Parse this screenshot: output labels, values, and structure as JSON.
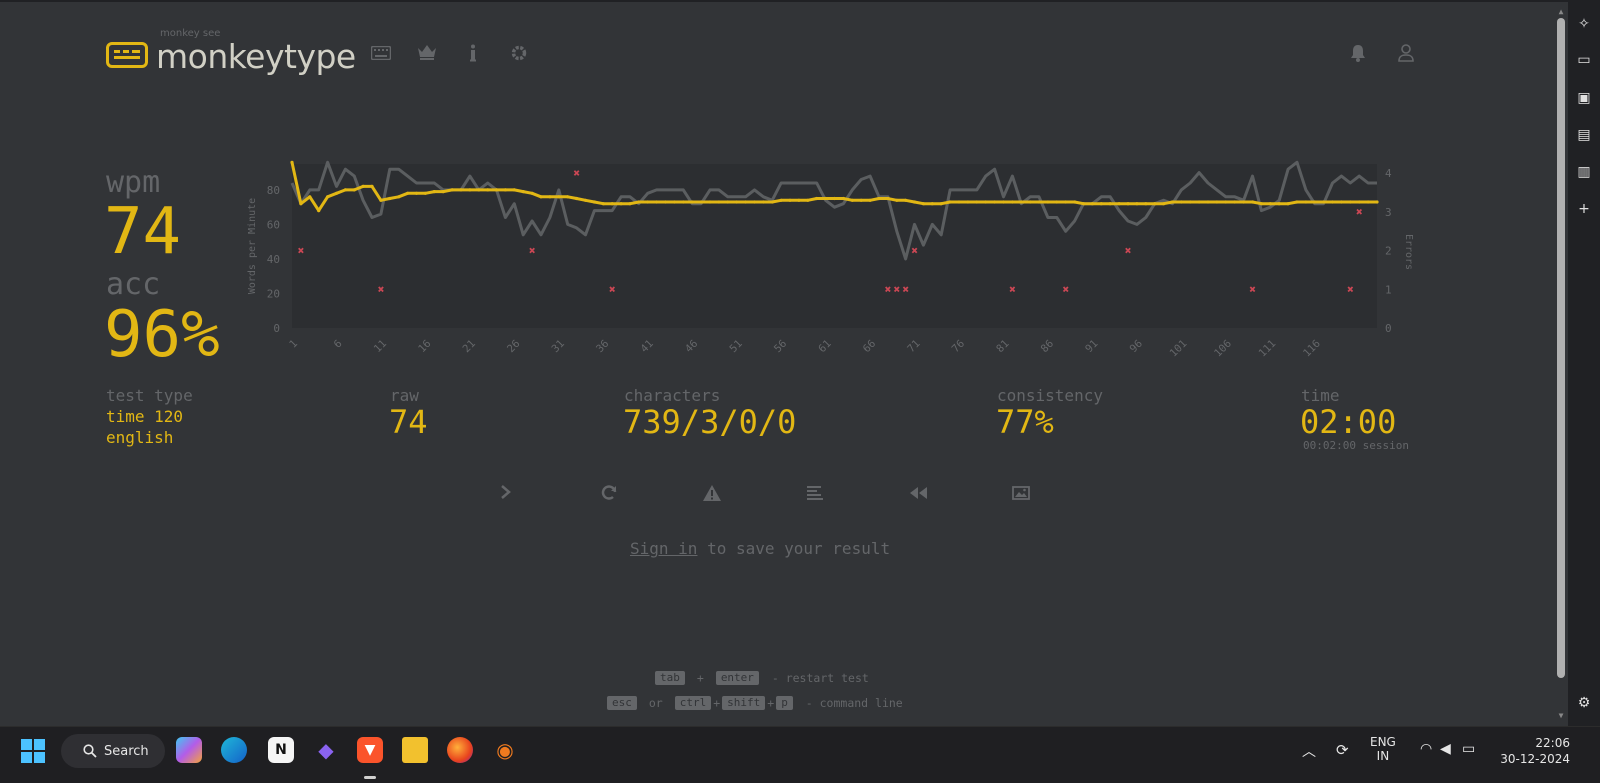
{
  "app": {
    "logo_small": "monkey see",
    "logo_title": "monkeytype",
    "nav_icons": [
      "keyboard-icon",
      "crown-icon",
      "info-icon",
      "gear-icon"
    ],
    "right_icons": [
      "bell-icon",
      "user-icon"
    ]
  },
  "result": {
    "wpm_label": "wpm",
    "wpm_value": "74",
    "acc_label": "acc",
    "acc_value": "96%",
    "test_type_label": "test type",
    "test_type_line1": "time 120",
    "test_type_line2": "english",
    "raw_label": "raw",
    "raw_value": "74",
    "characters_label": "characters",
    "characters_value": "739/3/0/0",
    "consistency_label": "consistency",
    "consistency_value": "77%",
    "time_label": "time",
    "time_value": "02:00",
    "session_value": "00:02:00 session"
  },
  "chart_data": {
    "type": "line",
    "ylabel": "Words per Minute",
    "y2label": "Errors",
    "ylim": [
      0,
      95
    ],
    "y2lim": [
      0,
      4
    ],
    "yticks": [
      "0",
      "20",
      "40",
      "60",
      "80"
    ],
    "y2ticks": [
      "0",
      "1",
      "2",
      "3",
      "4"
    ],
    "xticks": [
      "1",
      "6",
      "11",
      "16",
      "21",
      "26",
      "31",
      "36",
      "41",
      "46",
      "51",
      "56",
      "61",
      "66",
      "71",
      "76",
      "81",
      "86",
      "91",
      "96",
      "101",
      "106",
      "111",
      "116"
    ],
    "series": [
      {
        "name": "raw",
        "color": "#646669",
        "values": [
          84,
          72,
          80,
          80,
          96,
          82,
          92,
          88,
          74,
          64,
          66,
          92,
          92,
          88,
          84,
          84,
          84,
          80,
          80,
          80,
          88,
          80,
          84,
          80,
          64,
          72,
          54,
          62,
          54,
          64,
          80,
          60,
          58,
          54,
          68,
          68,
          68,
          76,
          76,
          72,
          78,
          80,
          80,
          80,
          80,
          72,
          72,
          80,
          80,
          76,
          76,
          76,
          80,
          76,
          74,
          84,
          84,
          84,
          84,
          84,
          74,
          70,
          72,
          80,
          86,
          88,
          76,
          76,
          56,
          40,
          60,
          48,
          60,
          54,
          80,
          80,
          80,
          80,
          88,
          92,
          76,
          88,
          72,
          76,
          76,
          64,
          64,
          56,
          62,
          72,
          72,
          76,
          76,
          68,
          62,
          60,
          64,
          72,
          74,
          72,
          80,
          84,
          90,
          84,
          80,
          76,
          76,
          74,
          88,
          68,
          70,
          74,
          92,
          96,
          80,
          72,
          72,
          84,
          88,
          84,
          88,
          84,
          84
        ]
      },
      {
        "name": "wpm",
        "color": "#e2b714",
        "values": [
          96,
          72,
          76,
          68,
          76,
          78,
          80,
          80,
          82,
          82,
          74,
          75,
          76,
          78,
          78,
          78,
          79,
          79,
          80,
          80,
          80,
          80,
          80,
          80,
          80,
          80,
          79,
          78,
          76,
          76,
          76,
          76,
          75,
          74,
          73,
          72,
          72,
          72,
          72,
          73,
          73,
          73,
          73,
          73,
          73,
          73,
          73,
          73,
          73,
          73,
          73,
          73,
          73,
          73,
          73,
          74,
          74,
          74,
          74,
          75,
          75,
          75,
          75,
          74,
          74,
          74,
          75,
          75,
          74,
          74,
          73,
          72,
          72,
          72,
          73,
          73,
          73,
          73,
          73,
          73,
          73,
          73,
          73,
          73,
          73,
          73,
          73,
          73,
          73,
          72,
          72,
          72,
          72,
          72,
          72,
          72,
          72,
          72,
          72,
          73,
          73,
          73,
          73,
          73,
          73,
          73,
          73,
          73,
          73,
          72,
          72,
          72,
          72,
          73,
          73,
          73,
          73,
          73,
          73,
          73,
          73,
          73,
          73
        ]
      }
    ],
    "errors": [
      {
        "x": 2,
        "count": 2
      },
      {
        "x": 11,
        "count": 1
      },
      {
        "x": 28,
        "count": 2
      },
      {
        "x": 33,
        "count": 4
      },
      {
        "x": 37,
        "count": 1
      },
      {
        "x": 68,
        "count": 1
      },
      {
        "x": 69,
        "count": 1
      },
      {
        "x": 70,
        "count": 1
      },
      {
        "x": 71,
        "count": 2
      },
      {
        "x": 82,
        "count": 1
      },
      {
        "x": 88,
        "count": 1
      },
      {
        "x": 95,
        "count": 2
      },
      {
        "x": 109,
        "count": 1
      },
      {
        "x": 120,
        "count": 1
      },
      {
        "x": 121,
        "count": 3
      }
    ],
    "error_color": "#ca4754"
  },
  "actions": [
    "next-test-icon",
    "restart-icon",
    "warning-icon",
    "words-history-icon",
    "replay-icon",
    "screenshot-icon"
  ],
  "signin": {
    "link": "Sign in",
    "rest": " to save your result"
  },
  "footer": {
    "line1": {
      "key1": "tab",
      "plus": "+",
      "key2": "enter",
      "desc": " - restart test"
    },
    "line2": {
      "key1": "esc",
      "or": "or",
      "key2": "ctrl",
      "key3": "shift",
      "key4": "p",
      "desc": " - command line"
    }
  },
  "taskbar": {
    "search": "Search",
    "lang1": "ENG",
    "lang2": "IN",
    "time": "22:06",
    "date": "30-12-2024"
  }
}
